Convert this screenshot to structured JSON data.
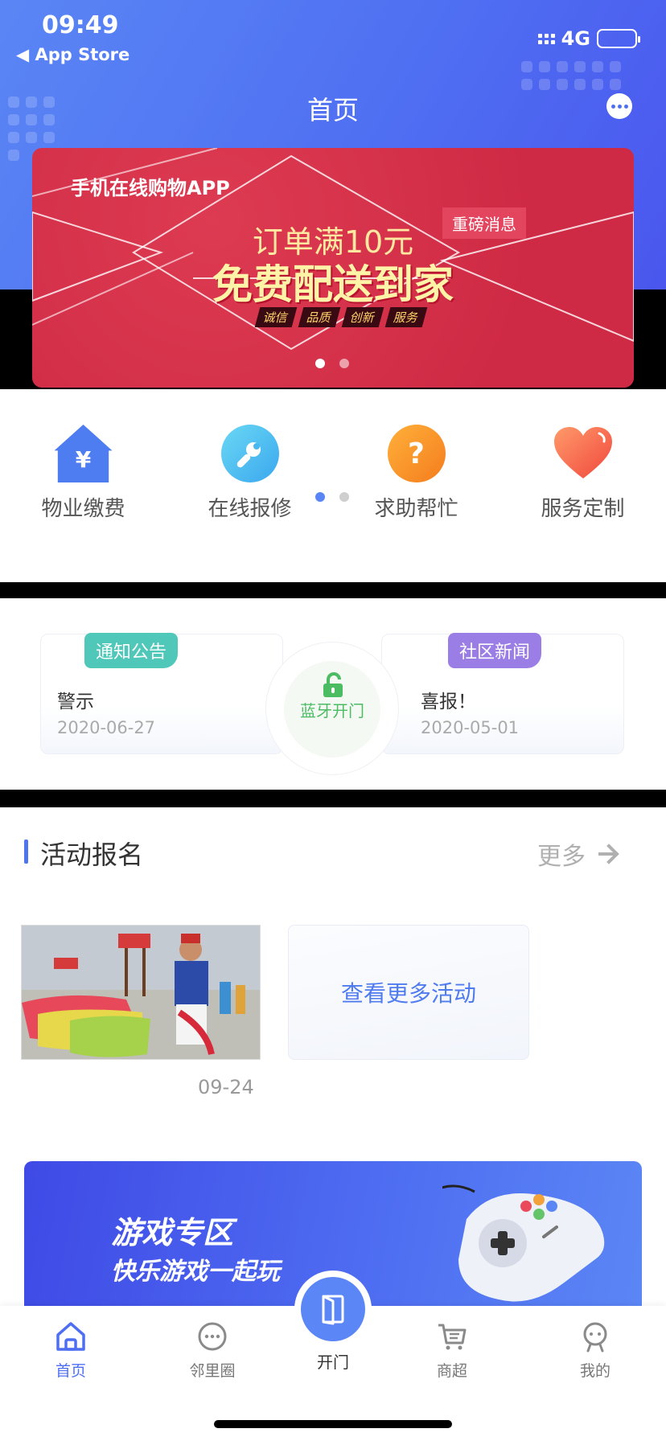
{
  "status_bar": {
    "time": "09:49",
    "back_app": "◀ App Store",
    "network": "4G"
  },
  "header": {
    "title": "首页"
  },
  "banner": {
    "app_name": "手机在线购物APP",
    "tag": "重磅消息",
    "line1": "订单满10元",
    "line2": "免费配送到家",
    "chips": [
      "诚信",
      "品质",
      "创新",
      "服务"
    ]
  },
  "menu": [
    {
      "label": "物业缴费",
      "icon": "house-yen-icon",
      "glyph": "¥"
    },
    {
      "label": "在线报修",
      "icon": "wrench-icon"
    },
    {
      "label": "求助帮忙",
      "icon": "question-icon",
      "glyph": "?"
    },
    {
      "label": "服务定制",
      "icon": "heart-icon"
    }
  ],
  "notices": {
    "left": {
      "tag": "通知公告",
      "title": "警示",
      "date": "2020-06-27"
    },
    "right": {
      "tag": "社区新闻",
      "title": "喜报！",
      "date": "2020-05-01"
    },
    "bluetooth": {
      "label": "蓝牙开门"
    }
  },
  "activities": {
    "title": "活动报名",
    "more": "更多",
    "items": [
      {
        "date": "09-24"
      }
    ],
    "more_card": "查看更多活动"
  },
  "game_banner": {
    "line1": "游戏专区",
    "line2": "快乐游戏一起玩"
  },
  "tabbar": [
    {
      "label": "首页",
      "active": true
    },
    {
      "label": "邻里圈"
    },
    {
      "label": "开门"
    },
    {
      "label": "商超"
    },
    {
      "label": "我的"
    }
  ],
  "colors": {
    "primary": "#4f6ff2",
    "banner_red": "#cf2a45",
    "notice_teal": "#4fc8b9",
    "news_purple": "#9b7de6",
    "bluetooth_green": "#4cbc63"
  }
}
